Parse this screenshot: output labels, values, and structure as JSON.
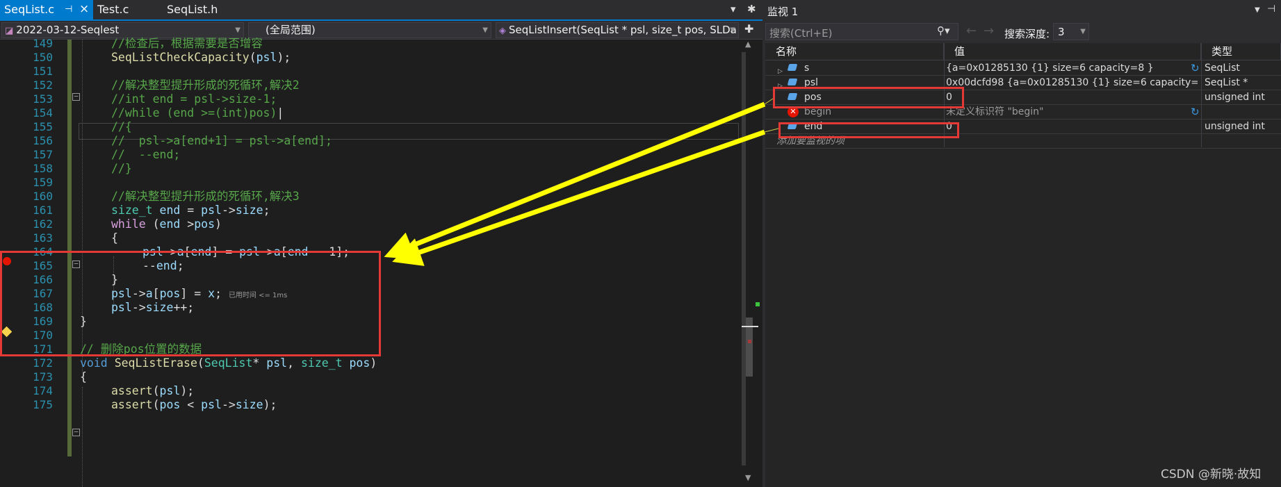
{
  "editor": {
    "tabs": [
      {
        "label": "SeqList.c",
        "active": true
      },
      {
        "label": "Test.c",
        "active": false
      },
      {
        "label": "SeqList.h",
        "active": false
      }
    ],
    "pin_glyph": "⊣",
    "close_glyph": "×",
    "overflow_glyph": "▾",
    "settings_glyph": "✱",
    "nav": {
      "project": "2022-03-12-Seqlest",
      "scope": "(全局范围)",
      "function": "SeqListInsert(SeqList * psl, size_t pos, SLDa"
    },
    "line_numbers": [
      "149",
      "150",
      "151",
      "152",
      "153",
      "154",
      "155",
      "156",
      "157",
      "158",
      "159",
      "160",
      "161",
      "162",
      "163",
      "164",
      "165",
      "166",
      "167",
      "168",
      "169",
      "170",
      "171",
      "172",
      "173",
      "174",
      "175"
    ],
    "elapsed_hint": "已用时间 <= 1ms"
  },
  "watch": {
    "title": "监视 1",
    "search_placeholder": "搜索(Ctrl+E)",
    "search_icon": "search-icon",
    "depth_label": "搜索深度:",
    "depth_value": "3",
    "columns": [
      "名称",
      "值",
      "类型"
    ],
    "rows": [
      {
        "name": "s",
        "value": "{a=0x01285130 {1} size=6 capacity=8 }",
        "type": "SeqList",
        "expandable": true,
        "icon": "variable-icon",
        "refresh": true
      },
      {
        "name": "psl",
        "value": "0x00dcfd98 {a=0x01285130 {1} size=6 capacity=8 }",
        "type": "SeqList *",
        "expandable": true,
        "icon": "variable-icon",
        "refresh": false
      },
      {
        "name": "pos",
        "value": "0",
        "type": "unsigned int",
        "expandable": false,
        "icon": "variable-icon",
        "refresh": false
      },
      {
        "name": "begin",
        "value": "未定义标识符 \"begin\"",
        "type": "",
        "expandable": false,
        "icon": "error-icon",
        "refresh": true
      },
      {
        "name": "end",
        "value": "0",
        "type": "unsigned int",
        "expandable": false,
        "icon": "variable-icon",
        "refresh": false
      }
    ],
    "add_item_placeholder": "添加要监视的项"
  },
  "watermark": "CSDN @新晓·故知",
  "colors": {
    "accent": "#007acc",
    "annotation_red": "#e53935",
    "annotation_yellow": "#ffff00",
    "comment": "#57a64a",
    "keyword": "#d8a0df",
    "line_number": "#2b91af"
  }
}
